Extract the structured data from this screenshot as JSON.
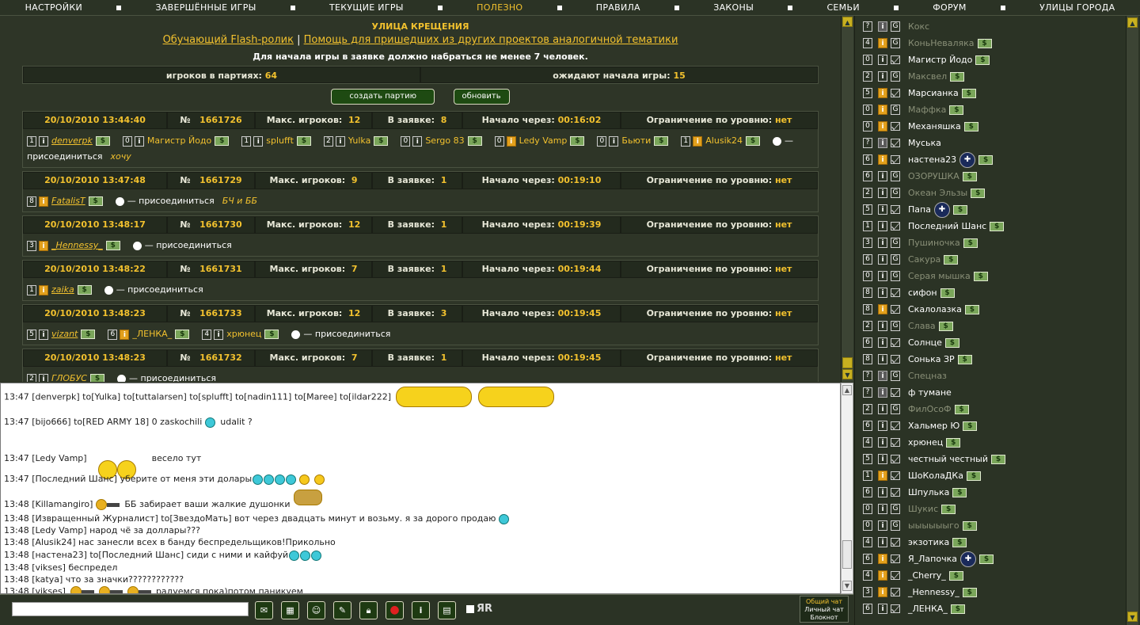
{
  "nav": [
    "НАСТРОЙКИ",
    "ЗАВЕРШЁННЫЕ ИГРЫ",
    "ТЕКУЩИЕ ИГРЫ",
    "ПОЛЕЗНО",
    "ПРАВИЛА",
    "ЗАКОНЫ",
    "СЕМЬИ",
    "ФОРУМ",
    "УЛИЦЫ ГОРОДА"
  ],
  "nav_active": "ПОЛЕЗНО",
  "street_title": "УЛИЦА КРЕЩЕНИЯ",
  "links": {
    "flash": "Обучающий Flash-ролик",
    "sep": "|",
    "help": "Помощь для пришедших из других проектов аналогичной тематики"
  },
  "notice": "Для начала игры в заявке должно набраться не менее 7 человек.",
  "stats": {
    "players_label": "игроков в партиях:",
    "players": "64",
    "waiting_label": "ожидают начала игры:",
    "waiting": "15"
  },
  "buttons": {
    "create": "создать партию",
    "refresh": "обновить"
  },
  "labels": {
    "num": "№",
    "max": "Макс. игроков:",
    "in_app": "В заявке:",
    "start": "Начало через:",
    "limit": "Ограничение по уровню:",
    "join": "— присоединиться",
    "dollar": "$"
  },
  "games": [
    {
      "date": "20/10/2010 13:44:40",
      "num": "1661726",
      "max": "12",
      "in_app": "8",
      "start": "00:16:02",
      "limit": "нет",
      "players": [
        {
          "lvl": "1",
          "info": "i",
          "name": "denverpk",
          "u": true
        },
        {
          "lvl": "0",
          "info": "i",
          "name": "Магистр Йодо"
        },
        {
          "lvl": "1",
          "info": "i",
          "name": "splufft"
        },
        {
          "lvl": "2",
          "info": "i",
          "name": "Yulka"
        },
        {
          "lvl": "0",
          "info": "i",
          "name": "Sergo 83"
        },
        {
          "lvl": "0",
          "info": "i",
          "name": "Ledy Vamp",
          "o": true
        },
        {
          "lvl": "0",
          "info": "i",
          "name": "Бьюти"
        },
        {
          "lvl": "1",
          "info": "i",
          "name": "Alusik24",
          "o": true
        }
      ],
      "note": "хочу"
    },
    {
      "date": "20/10/2010 13:47:48",
      "num": "1661729",
      "max": "9",
      "in_app": "1",
      "start": "00:19:10",
      "limit": "нет",
      "players": [
        {
          "lvl": "8",
          "info": "i",
          "name": "FatalisT",
          "u": true,
          "o": true
        }
      ],
      "note": "БЧ и ББ"
    },
    {
      "date": "20/10/2010 13:48:17",
      "num": "1661730",
      "max": "12",
      "in_app": "1",
      "start": "00:19:39",
      "limit": "нет",
      "players": [
        {
          "lvl": "3",
          "info": "i",
          "name": "_Hennessy_",
          "u": true,
          "o": true
        }
      ],
      "note": ""
    },
    {
      "date": "20/10/2010 13:48:22",
      "num": "1661731",
      "max": "7",
      "in_app": "1",
      "start": "00:19:44",
      "limit": "нет",
      "players": [
        {
          "lvl": "1",
          "info": "i",
          "name": "zaika",
          "u": true,
          "o": true
        }
      ],
      "note": ""
    },
    {
      "date": "20/10/2010 13:48:23",
      "num": "1661733",
      "max": "12",
      "in_app": "3",
      "start": "00:19:45",
      "limit": "нет",
      "players": [
        {
          "lvl": "5",
          "info": "i",
          "name": "vizant",
          "u": true
        },
        {
          "lvl": "6",
          "info": "i",
          "name": "_ЛЕНКА_",
          "o": true
        },
        {
          "lvl": "4",
          "info": "i",
          "name": "хрюнец"
        }
      ],
      "note": ""
    },
    {
      "date": "20/10/2010 13:48:23",
      "num": "1661732",
      "max": "7",
      "in_app": "1",
      "start": "00:19:45",
      "limit": "нет",
      "players": [
        {
          "lvl": "2",
          "info": "i",
          "name": "ГЛОБУС",
          "u": true
        }
      ],
      "note": ""
    }
  ],
  "chat": [
    {
      "text": "13:47 [denverpk] to[Yulka] to[tuttalarsen] to[splufft] to[nadin111] to[Maree] to[ildar222]",
      "emo": "crowd2"
    },
    {
      "text": "13:47 [bijo666] to[RED ARMY 18] 0 zaskochili",
      "tail": "udalit ?",
      "emo": "c1"
    },
    {
      "text": "13:47 [Ledy Vamp]",
      "tail": "весело тут",
      "emo": "pair"
    },
    {
      "text": "13:47 [Последний Шанс] уберите от меня эти долары",
      "emo": "c4y2"
    },
    {
      "text": "13:48 [Killamangiro]",
      "tail": "ББ забирает ваши жалкие душонки",
      "emo": "gun"
    },
    {
      "text": "13:48 [Извращенный Журналист] to[ЗвездоМать] вот через двадцать минут и возьму. я за дорого продаю",
      "emo": "c1"
    },
    {
      "text": "13:48 [Ledy Vamp] народ чё за доллары???",
      "emo": ""
    },
    {
      "text": "13:48 [Alusik24] нас занесли всех в банду беспредельщиков!Прикольно",
      "emo": ""
    },
    {
      "text": "13:48 [настена23] to[Последний Шанс] сиди с ними и кайфуй",
      "emo": "c3"
    },
    {
      "text": "13:48 [vikses] беспредел",
      "emo": ""
    },
    {
      "text": "13:48 [katya] что за значки????????????",
      "emo": ""
    },
    {
      "text": "13:48 [vikses]",
      "tail": "радуемся пока)потом паникуем",
      "emo": "gun3"
    }
  ],
  "chat_modes": {
    "general": "Общий чат",
    "private": "Личный чат",
    "notepad": "Блокнот"
  },
  "translit_label": "ЯR",
  "users": [
    {
      "lvl": "?",
      "i": "gray",
      "type": "G",
      "name": "Кокс",
      "off": true,
      "dollar": false
    },
    {
      "lvl": "4",
      "i": "o",
      "type": "G",
      "name": "КоньНеваляка",
      "off": true,
      "dollar": true
    },
    {
      "lvl": "0",
      "i": "n",
      "type": "M",
      "name": "Магистр Йодо",
      "off": false,
      "dollar": true
    },
    {
      "lvl": "2",
      "i": "n",
      "type": "G",
      "name": "Максвел",
      "off": true,
      "dollar": true
    },
    {
      "lvl": "5",
      "i": "o",
      "type": "M",
      "name": "Марсианка",
      "off": false,
      "dollar": true
    },
    {
      "lvl": "0",
      "i": "o",
      "type": "G",
      "name": "Маффка",
      "off": true,
      "dollar": true
    },
    {
      "lvl": "0",
      "i": "o",
      "type": "M",
      "name": "Механяшка",
      "off": false,
      "dollar": true
    },
    {
      "lvl": "?",
      "i": "gray",
      "type": "M",
      "name": "Муська",
      "off": false,
      "dollar": false
    },
    {
      "lvl": "6",
      "i": "o",
      "type": "M",
      "name": "настена23",
      "off": false,
      "dollar": true,
      "sign": true
    },
    {
      "lvl": "6",
      "i": "n",
      "type": "G",
      "name": "ОЗОРУШКА",
      "off": true,
      "dollar": true
    },
    {
      "lvl": "2",
      "i": "n",
      "type": "G",
      "name": "Океан Эльзы",
      "off": true,
      "dollar": true
    },
    {
      "lvl": "5",
      "i": "n",
      "type": "M",
      "name": "Папа",
      "off": false,
      "dollar": true,
      "sign": true
    },
    {
      "lvl": "1",
      "i": "n",
      "type": "M",
      "name": "Последний Шанс",
      "off": false,
      "dollar": true
    },
    {
      "lvl": "3",
      "i": "n",
      "type": "G",
      "name": "Пушиночка",
      "off": true,
      "dollar": true
    },
    {
      "lvl": "6",
      "i": "n",
      "type": "G",
      "name": "Сакура",
      "off": true,
      "dollar": true
    },
    {
      "lvl": "0",
      "i": "n",
      "type": "G",
      "name": "Серая мышка",
      "off": true,
      "dollar": true
    },
    {
      "lvl": "8",
      "i": "n",
      "type": "M",
      "name": "сифон",
      "off": false,
      "dollar": true
    },
    {
      "lvl": "8",
      "i": "o",
      "type": "M",
      "name": "Скалолазка",
      "off": false,
      "dollar": true
    },
    {
      "lvl": "2",
      "i": "n",
      "type": "G",
      "name": "Слава",
      "off": true,
      "dollar": true
    },
    {
      "lvl": "6",
      "i": "n",
      "type": "M",
      "name": "Солнце",
      "off": false,
      "dollar": true
    },
    {
      "lvl": "8",
      "i": "n",
      "type": "M",
      "name": "Сонька ЗР",
      "off": false,
      "dollar": true
    },
    {
      "lvl": "?",
      "i": "gray",
      "type": "G",
      "name": "Спецназ",
      "off": true,
      "dollar": false
    },
    {
      "lvl": "?",
      "i": "gray",
      "type": "M",
      "name": "ф тумане",
      "off": false,
      "dollar": false
    },
    {
      "lvl": "2",
      "i": "n",
      "type": "G",
      "name": "ФилОсоФ",
      "off": true,
      "dollar": true
    },
    {
      "lvl": "6",
      "i": "n",
      "type": "M",
      "name": "Хальмер Ю",
      "off": false,
      "dollar": true
    },
    {
      "lvl": "4",
      "i": "n",
      "type": "M",
      "name": "хрюнец",
      "off": false,
      "dollar": true
    },
    {
      "lvl": "5",
      "i": "n",
      "type": "M",
      "name": "честный честный",
      "off": false,
      "dollar": true
    },
    {
      "lvl": "1",
      "i": "o",
      "type": "M",
      "name": "ШоКолаДКа",
      "off": false,
      "dollar": true
    },
    {
      "lvl": "6",
      "i": "n",
      "type": "M",
      "name": "Шпулька",
      "off": false,
      "dollar": true
    },
    {
      "lvl": "0",
      "i": "n",
      "type": "G",
      "name": "Шукис",
      "off": true,
      "dollar": true
    },
    {
      "lvl": "0",
      "i": "n",
      "type": "G",
      "name": "ыыыыыыго",
      "off": true,
      "dollar": true
    },
    {
      "lvl": "4",
      "i": "n",
      "type": "M",
      "name": "экзотика",
      "off": false,
      "dollar": true
    },
    {
      "lvl": "6",
      "i": "o",
      "type": "M",
      "name": "Я_Лапочка",
      "off": false,
      "dollar": true,
      "sign": true
    },
    {
      "lvl": "4",
      "i": "o",
      "type": "M",
      "name": "_Cherry_",
      "off": false,
      "dollar": true
    },
    {
      "lvl": "3",
      "i": "o",
      "type": "M",
      "name": "_Hennessy_",
      "off": false,
      "dollar": true
    },
    {
      "lvl": "6",
      "i": "n",
      "type": "M",
      "name": "_ЛЕНКА_",
      "off": false,
      "dollar": true
    }
  ],
  "colors": {
    "bg": "#2b3325",
    "accent": "#f2c12e",
    "panel": "#232a1e",
    "button": "#1e4a12",
    "info_orange": "#e2a01c"
  }
}
